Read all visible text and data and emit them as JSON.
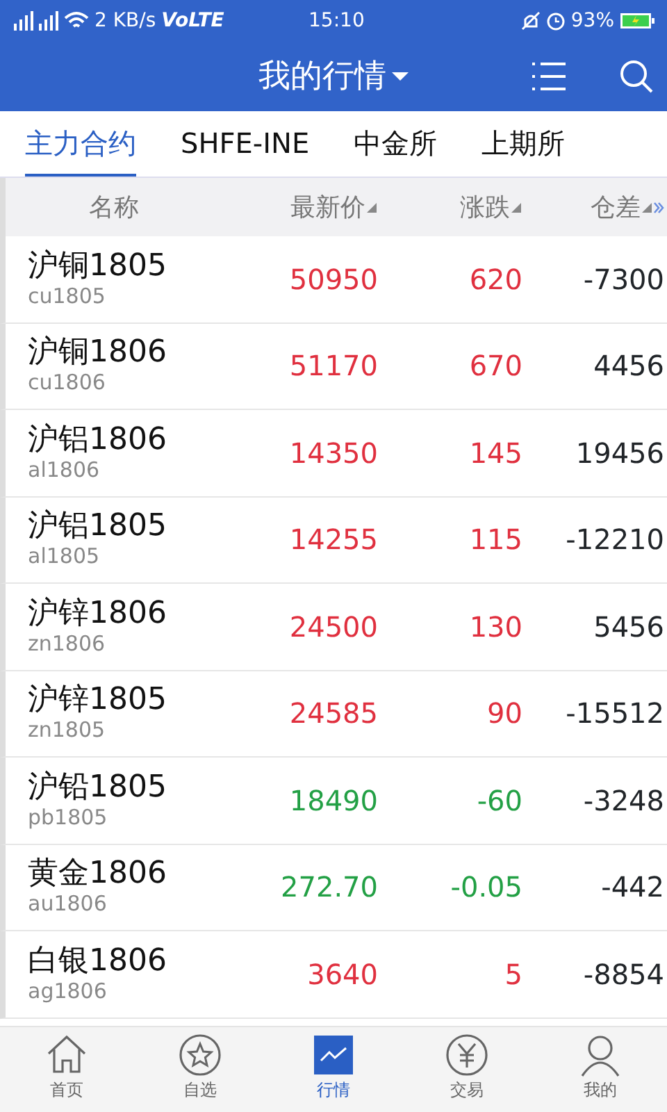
{
  "status_bar": {
    "speed": "2 KB/s",
    "volte": "VoLTE",
    "time": "15:10",
    "battery": "93%"
  },
  "header": {
    "title": "我的行情"
  },
  "tabs": [
    {
      "label": "主力合约",
      "selected": true
    },
    {
      "label": "SHFE-INE",
      "selected": false
    },
    {
      "label": "中金所",
      "selected": false
    },
    {
      "label": "上期所",
      "selected": false
    }
  ],
  "table": {
    "columns": [
      "名称",
      "最新价",
      "涨跌",
      "仓差"
    ],
    "rows": [
      {
        "name": "沪铜1805",
        "code": "cu1805",
        "price": "50950",
        "change": "620",
        "oi_change": "-7300",
        "color": "#e0303f"
      },
      {
        "name": "沪铜1806",
        "code": "cu1806",
        "price": "51170",
        "change": "670",
        "oi_change": "4456",
        "color": "#e0303f"
      },
      {
        "name": "沪铝1806",
        "code": "al1806",
        "price": "14350",
        "change": "145",
        "oi_change": "19456",
        "color": "#e0303f"
      },
      {
        "name": "沪铝1805",
        "code": "al1805",
        "price": "14255",
        "change": "115",
        "oi_change": "-12210",
        "color": "#e0303f"
      },
      {
        "name": "沪锌1806",
        "code": "zn1806",
        "price": "24500",
        "change": "130",
        "oi_change": "5456",
        "color": "#e0303f"
      },
      {
        "name": "沪锌1805",
        "code": "zn1805",
        "price": "24585",
        "change": "90",
        "oi_change": "-15512",
        "color": "#e0303f"
      },
      {
        "name": "沪铅1805",
        "code": "pb1805",
        "price": "18490",
        "change": "-60",
        "oi_change": "-3248",
        "color": "#23a045"
      },
      {
        "name": "黄金1806",
        "code": "au1806",
        "price": "272.70",
        "change": "-0.05",
        "oi_change": "-442",
        "color": "#23a045"
      },
      {
        "name": "白银1806",
        "code": "ag1806",
        "price": "3640",
        "change": "5",
        "oi_change": "-8854",
        "color": "#e0303f"
      }
    ]
  },
  "bottom_nav": [
    {
      "label": "首页",
      "kind": "home",
      "selected": false
    },
    {
      "label": "自选",
      "kind": "star",
      "selected": false
    },
    {
      "label": "行情",
      "kind": "chart",
      "selected": true
    },
    {
      "label": "交易",
      "kind": "yen",
      "selected": false
    },
    {
      "label": "我的",
      "kind": "person",
      "selected": false
    }
  ]
}
